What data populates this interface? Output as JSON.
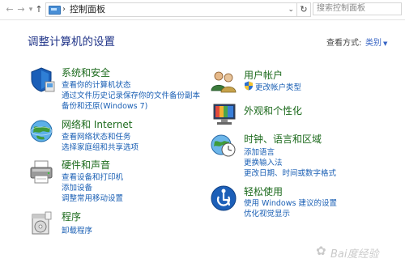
{
  "address_bar": {
    "path_label": "控制面板",
    "search_placeholder": "搜索控制面板"
  },
  "header": {
    "title": "调整计算机的设置",
    "view_by_label": "查看方式:",
    "view_by_value": "类别"
  },
  "categories_left": [
    {
      "icon": "shield-icon",
      "title": "系统和安全",
      "links": [
        "查看你的计算机状态",
        "通过文件历史记录保存你的文件备份副本",
        "备份和还原(Windows 7)"
      ]
    },
    {
      "icon": "globe-network-icon",
      "title": "网络和 Internet",
      "links": [
        "查看网络状态和任务",
        "选择家庭组和共享选项"
      ]
    },
    {
      "icon": "printer-icon",
      "title": "硬件和声音",
      "links": [
        "查看设备和打印机",
        "添加设备",
        "调整常用移动设置"
      ]
    },
    {
      "icon": "programs-icon",
      "title": "程序",
      "links": [
        "卸载程序"
      ]
    }
  ],
  "categories_right": [
    {
      "icon": "user-accounts-icon",
      "title": "用户帐户",
      "links": [
        "更改帐户类型"
      ]
    },
    {
      "icon": "appearance-icon",
      "title": "外观和个性化",
      "links": []
    },
    {
      "icon": "clock-globe-icon",
      "title": "时钟、语言和区域",
      "links": [
        "添加语言",
        "更换输入法",
        "更改日期、时间或数字格式"
      ]
    },
    {
      "icon": "ease-of-access-icon",
      "title": "轻松使用",
      "links": [
        "使用 Windows 建议的设置",
        "优化视觉显示"
      ]
    }
  ],
  "watermark": {
    "text": "Bai度经验"
  },
  "colors": {
    "heading_green": "#1c6a1c",
    "link_blue": "#1a5fb4",
    "title_blue": "#1e3287"
  }
}
